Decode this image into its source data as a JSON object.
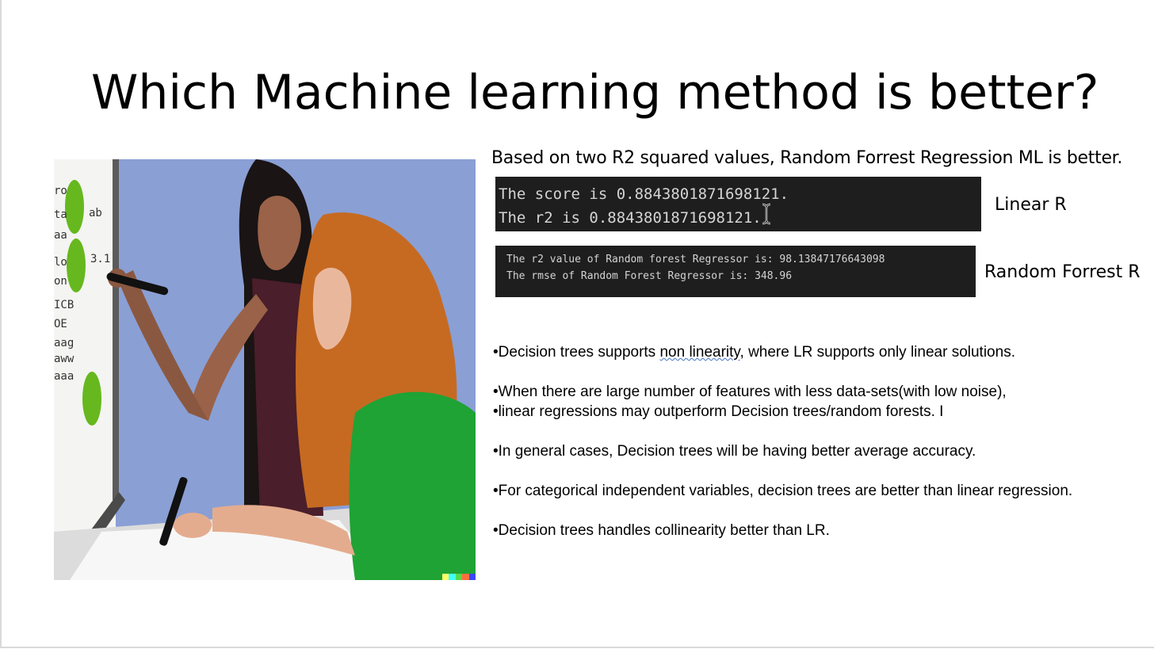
{
  "slide": {
    "title": "Which Machine learning method is better?",
    "summary": "Based on two R2 squared values, Random Forrest Regression  ML is better.",
    "linear_output": {
      "line1": "The score is 0.8843801871698121.",
      "line2": "The r2 is 0.8843801871698121."
    },
    "linear_label": "Linear R",
    "rf_output": {
      "line1": "The r2 value of Random forest Regressor is: 98.13847176643098",
      "line2": "The rmse of Random Forest Regressor is: 348.96"
    },
    "rf_label": "Random Forrest R",
    "bullets": {
      "b1_pre": "•Decision trees supports ",
      "b1_link": "non linearity",
      "b1_post": ", where LR supports only linear solutions.",
      "b2a": "•When there are large number of features with less data-sets(with low noise),",
      "b2b": "•linear regressions may outperform Decision trees/random forests. I",
      "b3": "•In general cases, Decision trees will be having better average accuracy.",
      "b4": "•For categorical independent variables, decision trees are better than linear regression.",
      "b5": "•Decision trees handles collinearity better than LR."
    },
    "image": {
      "description_icon": "illustration-two-students-whiteboard",
      "palette": [
        "#ffff66",
        "#42ffff",
        "#51da4c",
        "#ff6e3c",
        "#3c46ff"
      ]
    }
  }
}
